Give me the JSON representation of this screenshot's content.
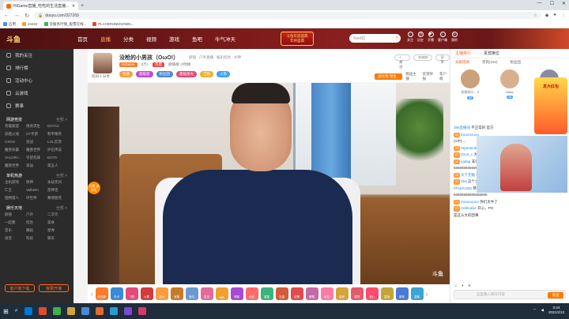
{
  "browser": {
    "tab_title": "HiGame直播_吃吃的生活直播...",
    "new_tab": "+",
    "url": "douyu.com/327269",
    "bookmarks": [
      "应用",
      "24422",
      "云服务行情_股票在线...",
      "PLAYERUNKNOWN..."
    ],
    "controls": [
      "—",
      "☐",
      "✕"
    ]
  },
  "site": {
    "logo": "斗鱼",
    "nav": [
      "首页",
      "直播",
      "分类",
      "视频",
      "游戏",
      "鱼吧",
      "牛气冲天"
    ],
    "nav_active_index": 1,
    "event_line1": "斗鱼年度盛典",
    "event_line2": "年终盛典",
    "search_placeholder": "Nset狂",
    "header_icons": [
      "关注",
      "历史",
      "开播",
      "客户端",
      "我的"
    ]
  },
  "sidebar": {
    "top_items": [
      "我的关注",
      "排行榜",
      "活动中心",
      "云游戏",
      "赛事"
    ],
    "section_hot": "网游竞技",
    "section_more": "全部 >",
    "hot_games": [
      "英雄联盟",
      "绝地求生",
      "DOTA2",
      "穿越火线",
      "CF手游",
      "和平精英",
      "CSGO",
      "逆战",
      "LOL云顶",
      "魔兽争霸",
      "魔兽世界",
      "炉石传说",
      "VALORA...",
      "守望先锋",
      "DOTA",
      "魔兽世界",
      "诛仙",
      "第五人"
    ],
    "section_mobile": "单机热游",
    "mobile_more": "全部 >",
    "mobile_games": [
      "主机游戏",
      "原神",
      "永劫无间",
      "仁王",
      "Valheim",
      "黑神话",
      "怪物猎人",
      "环世界",
      "赛博朋克"
    ],
    "section_fun": "娱乐天地",
    "fun_more": "全部 >",
    "fun_items": [
      "颜值",
      "户外",
      "二次元",
      "一起看",
      "综合",
      "美食",
      "音乐",
      "舞蹈",
      "星秀",
      "语音",
      "科技",
      "聊天"
    ],
    "btn_client": "客户端下载",
    "btn_live": "我要开播"
  },
  "room": {
    "avatar_label": "房间 1 分享",
    "title": "没枪的小男孩（OωO!）",
    "category": "颜值 · 户外直播 · 娱乐综合 · 大神",
    "meta_id": "HiGame",
    "meta_fans": "2万+",
    "meta_hot": "热度",
    "meta_rank": "颜值榜 小时榜",
    "badges": [
      "鱼塘",
      "超级星",
      "粉丝团",
      "超级星光",
      "万粉",
      "火箭"
    ],
    "follow_label": "+ 关注",
    "follow_count": "31800",
    "share_label": "分享",
    "tools": [
      "赠送主播",
      "反馈举报",
      "客户端"
    ],
    "gift_label": "送礼物 领鱼丸"
  },
  "video": {
    "watermark": "斗鱼",
    "deco_label": "开播 送好礼"
  },
  "giftbar": {
    "gifts": [
      {
        "name": "荧光棒",
        "color": "#ff7a2a"
      },
      {
        "name": "办卡",
        "color": "#3a8ad4"
      },
      {
        "name": "飞机",
        "color": "#e44a7a"
      },
      {
        "name": "火箭",
        "color": "#d43a3a"
      },
      {
        "name": "超火",
        "color": "#ff9a3a"
      },
      {
        "name": "宝箱",
        "color": "#c87a2a"
      },
      {
        "name": "鱼丸",
        "color": "#6a9ad4"
      },
      {
        "name": "告白",
        "color": "#e46a9a"
      },
      {
        "name": "666",
        "color": "#f0a030"
      },
      {
        "name": "神豪",
        "color": "#a44ad4"
      },
      {
        "name": "粉丝",
        "color": "#ff6a6a"
      },
      {
        "name": "星星",
        "color": "#3ab47a"
      },
      {
        "name": "礼盒",
        "color": "#d45a3a"
      },
      {
        "name": "玫瑰",
        "color": "#e44a4a"
      },
      {
        "name": "蛋糕",
        "color": "#c46aa4"
      },
      {
        "name": "鲜花",
        "color": "#ff7aa4"
      },
      {
        "name": "奖杯",
        "color": "#d4a43a"
      },
      {
        "name": "香吻",
        "color": "#e45a6a"
      },
      {
        "name": "爱心",
        "color": "#ff4a6a"
      },
      {
        "name": "皇冠",
        "color": "#c4a43a"
      },
      {
        "name": "跑车",
        "color": "#4a7ad4"
      },
      {
        "name": "游艇",
        "color": "#3aa4d4"
      }
    ]
  },
  "right": {
    "tabs": [
      "主播排行",
      "贵宾席位"
    ],
    "sub": [
      "贡献周榜",
      "贵宾(152)",
      "粉丝团"
    ],
    "ranks": [
      {
        "name": "优帮的小... 9",
        "lvl": "46",
        "color": "#c9a27a"
      },
      {
        "name": "Nikko",
        "lvl": "38",
        "color": "#d8b090"
      },
      {
        "name": "Treyaan的...",
        "lvl": "35",
        "color": "#8a8aa0"
      }
    ],
    "chat": [
      {
        "nm": "386直播间",
        "lv": "",
        "txt": "不正常的 官方"
      },
      {
        "nm": "Zoooooooo",
        "lv": "34",
        "txt": ""
      },
      {
        "nm": "",
        "lv": "",
        "txt": "(VIP)...."
      },
      {
        "nm": "Hijandeobo",
        "lv": "28",
        "txt": ""
      },
      {
        "nm": "Dxcd_c",
        "lv": "21",
        "txt": "大哥了"
      },
      {
        "nm": "ygdag",
        "lv": "18",
        "txt": "非常牛逼！"
      },
      {
        "nm": "",
        "lv": "",
        "txt": "666666666666666666666"
      },
      {
        "nm": "天下无敌",
        "lv": "15",
        "txt": "吃吃的 兄弟"
      },
      {
        "nm": "bbq",
        "lv": "12",
        "txt": "这个主播真是太搞笑了"
      },
      {
        "nm": "#P1601255",
        "lv": "",
        "txt": "恭喜你好 爱你了"
      },
      {
        "nm": "",
        "lv": "",
        "txt": "66666666666666666"
      },
      {
        "nm": "Zoooooooo",
        "lv": "34",
        "txt": "你们太牛了"
      },
      {
        "nm": "Helimalaz",
        "lv": "22",
        "txt": "开心，PG"
      },
      {
        "nm": "",
        "lv": "",
        "txt": "是这么大的回事"
      }
    ],
    "chat_placeholder": "这里输入聊天内容",
    "send_label": "发送",
    "promo": "发大红包"
  },
  "taskbar": {
    "time": "0:44",
    "date": "2021/2/13",
    "icons": [
      "#0078d7",
      "#e44a2a",
      "#3ab44a",
      "#d4a43a",
      "#4a8ad4",
      "#e46a2a",
      "#2a9ad4",
      "#7a4ad4",
      "#d43a6a"
    ]
  }
}
